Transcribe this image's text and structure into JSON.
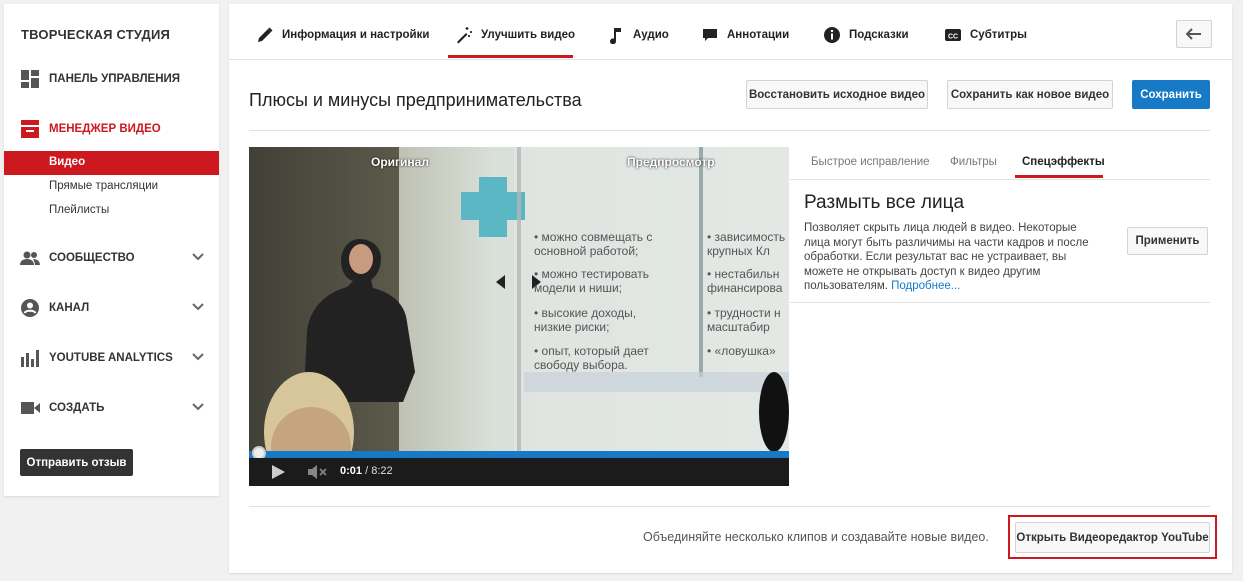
{
  "sidebar": {
    "title": "ТВОРЧЕСКАЯ СТУДИЯ",
    "items": [
      {
        "label": "ПАНЕЛЬ УПРАВЛЕНИЯ",
        "icon": "dashboard-icon"
      },
      {
        "label": "МЕНЕДЖЕР ВИДЕО",
        "icon": "video-manager-icon"
      },
      {
        "label": "СООБЩЕСТВО",
        "icon": "community-icon"
      },
      {
        "label": "КАНАЛ",
        "icon": "channel-icon"
      },
      {
        "label": "YOUTUBE ANALYTICS",
        "icon": "analytics-icon"
      },
      {
        "label": "СОЗДАТЬ",
        "icon": "create-icon"
      }
    ],
    "subitems": [
      {
        "label": "Видео"
      },
      {
        "label": "Прямые трансляции"
      },
      {
        "label": "Плейлисты"
      }
    ],
    "feedback_label": "Отправить отзыв",
    "accent_color": "#cc181e"
  },
  "tabs": [
    {
      "label": "Информация и настройки",
      "icon": "pencil-icon"
    },
    {
      "label": "Улучшить видео",
      "icon": "magic-wand-icon"
    },
    {
      "label": "Аудио",
      "icon": "music-note-icon"
    },
    {
      "label": "Аннотации",
      "icon": "speech-bubble-icon"
    },
    {
      "label": "Подсказки",
      "icon": "info-icon"
    },
    {
      "label": "Субтитры",
      "icon": "cc-icon"
    }
  ],
  "header": {
    "title": "Плюсы и минусы предпринимательства",
    "restore_label": "Восстановить исходное видео",
    "save_new_label": "Сохранить как новое видео",
    "save_label": "Сохранить"
  },
  "player": {
    "original_label": "Оригинал",
    "preview_label": "Предпросмотр",
    "time_current": "0:01",
    "time_total": " / 8:22",
    "slide_lines_left": [
      "• можно совмещать с",
      "  основной работой;",
      "• можно тестировать",
      "  модели и ниши;",
      "• высокие доходы,",
      "  низкие риски;",
      "• опыт, который дает",
      "  свободу выбора."
    ],
    "slide_lines_right": [
      "• зависимость",
      "  крупных Кл",
      "• нестабильн",
      "  финансирова",
      "• трудности н",
      "  масштабир",
      "• «ловушка»"
    ]
  },
  "effects": {
    "tabs": [
      "Быстрое исправление",
      "Фильтры",
      "Спецэффекты"
    ],
    "title": "Размыть все лица",
    "description": "Позволяет скрыть лица людей в видео. Некоторые лица могут быть различимы на части кадров и после обработки. Если результат вас не устраивает, вы можете не открывать доступ к видео другим пользователям.",
    "more_link": "Подробнее...",
    "apply_label": "Применить"
  },
  "footer": {
    "promo_text": "Объединяйте несколько клипов и создавайте новые видео.",
    "editor_label": "Открыть Видеоредактор YouTube"
  }
}
